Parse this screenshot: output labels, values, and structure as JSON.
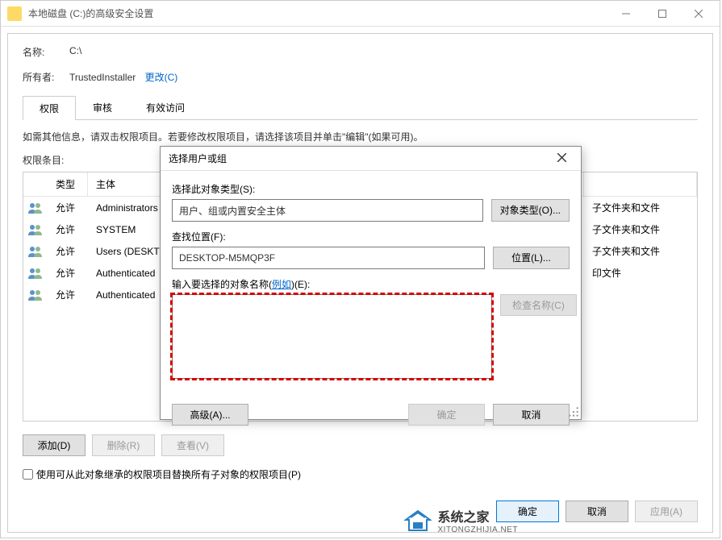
{
  "window": {
    "title": "本地磁盘 (C:)的高级安全设置",
    "name_label": "名称:",
    "name_value": "C:\\",
    "owner_label": "所有者:",
    "owner_value": "TrustedInstaller",
    "owner_change_link": "更改(C)",
    "tabs": [
      "权限",
      "审核",
      "有效访问"
    ],
    "description": "如需其他信息，请双击权限项目。若要修改权限项目，请选择该项目并单击\"编辑\"(如果可用)。",
    "perm_entries_label": "权限条目:",
    "table_headers": {
      "type": "类型",
      "principal": "主体"
    },
    "rows": [
      {
        "type": "允许",
        "principal": "Administrators",
        "applies": "子文件夹和文件"
      },
      {
        "type": "允许",
        "principal": "SYSTEM",
        "applies": "子文件夹和文件"
      },
      {
        "type": "允许",
        "principal": "Users (DESKTO",
        "applies": "子文件夹和文件"
      },
      {
        "type": "允许",
        "principal": "Authenticated",
        "applies": "印文件"
      },
      {
        "type": "允许",
        "principal": "Authenticated",
        "applies": ""
      }
    ],
    "btn_add": "添加(D)",
    "btn_remove": "删除(R)",
    "btn_view": "查看(V)",
    "checkbox_label": "使用可从此对象继承的权限项目替换所有子对象的权限项目(P)",
    "btn_ok": "确定",
    "btn_cancel": "取消",
    "btn_apply": "应用(A)"
  },
  "dialog": {
    "title": "选择用户或组",
    "object_type_label": "选择此对象类型(S):",
    "object_type_value": "用户、组或内置安全主体",
    "btn_object_types": "对象类型(O)...",
    "location_label": "查找位置(F):",
    "location_value": "DESKTOP-M5MQP3F",
    "btn_locations": "位置(L)...",
    "names_label_pre": "输入要选择的对象名称(",
    "names_label_link": "例如",
    "names_label_post": ")(E):",
    "btn_check_names": "检查名称(C)",
    "btn_advanced": "高级(A)...",
    "btn_ok": "确定",
    "btn_cancel": "取消"
  },
  "watermark": {
    "name": "系统之家",
    "url": "XITONGZHIJIA.NET"
  }
}
